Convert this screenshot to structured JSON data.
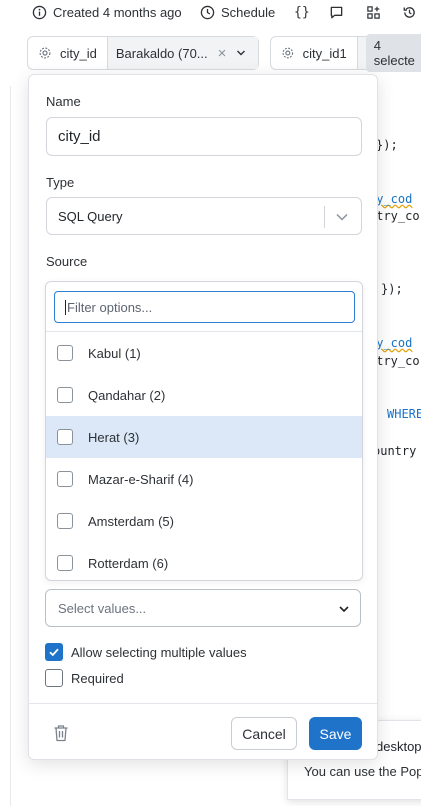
{
  "topbar": {
    "created": "Created 4 months ago",
    "schedule": "Schedule",
    "braces": "{}"
  },
  "params": [
    {
      "name": "city_id",
      "value": "Barakaldo (70...",
      "clear": "×"
    },
    {
      "name": "city_id1",
      "badge": "4 selecte"
    }
  ],
  "editor": {
    "lines": [
      "});",
      "ry_cod",
      "ntry_co",
      "});",
      "ry_cod",
      "ntry_co",
      "WHERE",
      "ountry"
    ]
  },
  "popover": {
    "name_label": "Name",
    "name_value": "city_id",
    "type_label": "Type",
    "type_value": "SQL Query",
    "source_label": "Source",
    "filter_placeholder": "Filter options...",
    "options": [
      {
        "label": "Kabul (1)",
        "highlighted": false
      },
      {
        "label": "Qandahar (2)",
        "highlighted": false
      },
      {
        "label": "Herat (3)",
        "highlighted": true
      },
      {
        "label": "Mazar-e-Sharif (4)",
        "highlighted": false
      },
      {
        "label": "Amsterdam (5)",
        "highlighted": false
      },
      {
        "label": "Rotterdam (6)",
        "highlighted": false
      }
    ],
    "values_placeholder": "Select values...",
    "allow_multiple_label": "Allow selecting multiple values",
    "allow_multiple_checked": true,
    "required_label": "Required",
    "required_checked": false,
    "cancel_label": "Cancel",
    "save_label": "Save"
  },
  "toast": {
    "title": "desktop",
    "text": "You can use the Pop"
  },
  "colors": {
    "accent": "#1f73c9",
    "highlight": "#dce8f7"
  }
}
